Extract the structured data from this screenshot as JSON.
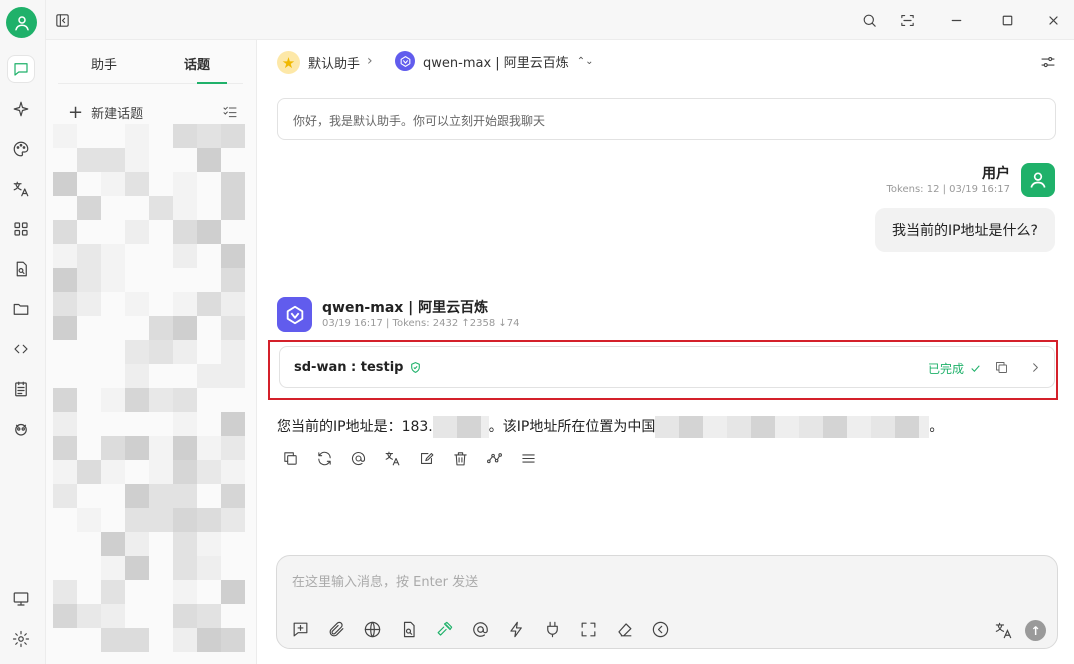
{
  "topics_panel": {
    "tabs": [
      "助手",
      "话题"
    ],
    "active_tab": "话题",
    "new_topic_label": "新建话题"
  },
  "header": {
    "assistant_name": "默认助手",
    "model_name": "qwen-max | 阿里云百炼"
  },
  "greeting": "你好，我是默认助手。你可以立刻开始跟我聊天",
  "user_message": {
    "name": "用户",
    "meta": "Tokens: 12 | 03/19 16:17",
    "text": "我当前的IP地址是什么?"
  },
  "bot_message": {
    "name": "qwen-max | 阿里云百炼",
    "meta": "03/19 16:17 | Tokens: 2432 ↑2358 ↓74",
    "tool_call": {
      "name": "sd-wan : testip",
      "status": "已完成"
    },
    "answer_prefix": "您当前的IP地址是：183.",
    "answer_middle": "。该IP地址所在位置为中国",
    "answer_suffix": "。"
  },
  "input": {
    "placeholder": "在这里输入消息，按 Enter 发送"
  },
  "colors": {
    "accent": "#1fb16a",
    "model_purple": "#615ced",
    "highlight_red": "#d4202a"
  }
}
